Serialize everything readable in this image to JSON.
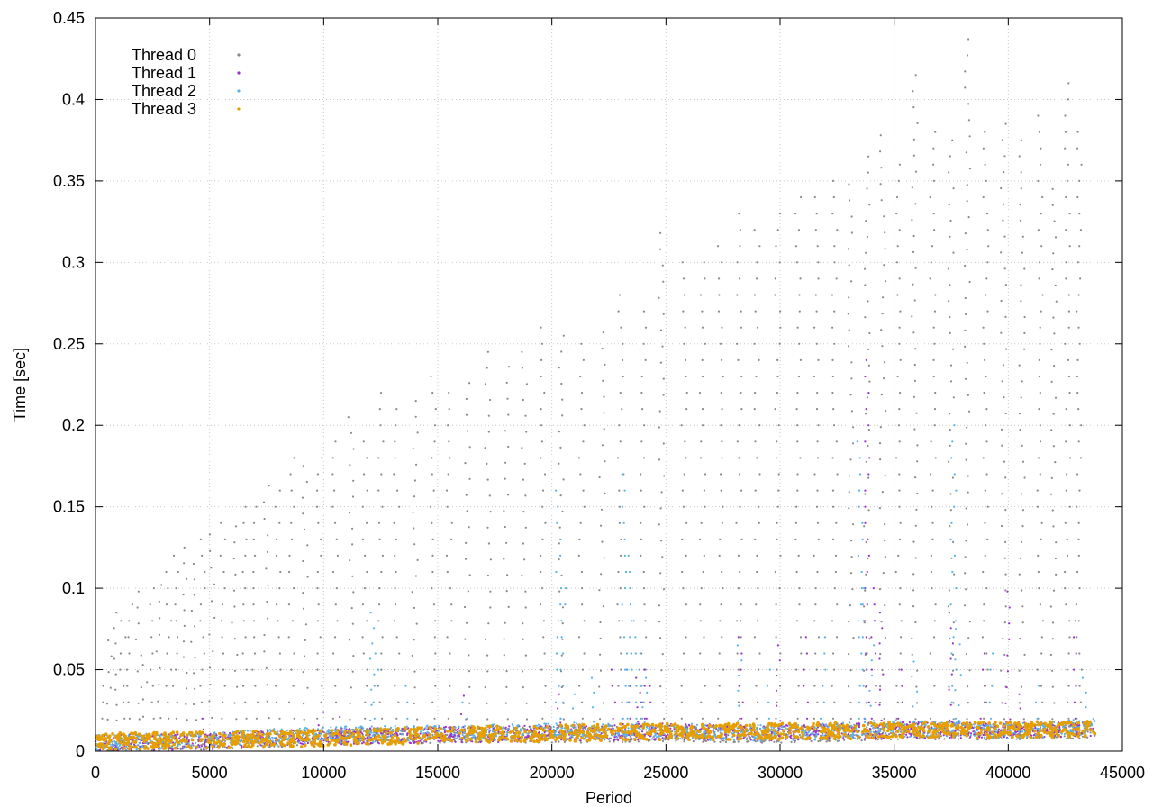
{
  "chart_data": {
    "type": "scatter",
    "title": "",
    "xlabel": "Period",
    "ylabel": "Time [sec]",
    "xlim": [
      0,
      45000
    ],
    "ylim": [
      0,
      0.45
    ],
    "x_ticks": [
      0,
      5000,
      10000,
      15000,
      20000,
      25000,
      30000,
      35000,
      40000,
      45000
    ],
    "x_tick_labels": [
      "0",
      "5000",
      "10000",
      "15000",
      "20000",
      "25000",
      "30000",
      "35000",
      "40000",
      "45000"
    ],
    "y_ticks": [
      0,
      0.05,
      0.1,
      0.15,
      0.2,
      0.25,
      0.3,
      0.35,
      0.4,
      0.45
    ],
    "y_tick_labels": [
      "0",
      "0.05",
      "0.1",
      "0.15",
      "0.2",
      "0.25",
      "0.3",
      "0.35",
      "0.4",
      "0.45"
    ],
    "grid": true,
    "legend_position": "top-left",
    "x_extent": 43800,
    "series": [
      {
        "name": "Thread 0",
        "color": "#8a8a8a",
        "baseline": [
          [
            0,
            0.004
          ],
          [
            5000,
            0.006
          ],
          [
            10000,
            0.008
          ],
          [
            15000,
            0.01
          ],
          [
            20000,
            0.01
          ],
          [
            25000,
            0.011
          ],
          [
            30000,
            0.01
          ],
          [
            35000,
            0.012
          ],
          [
            40000,
            0.012
          ],
          [
            43800,
            0.013
          ]
        ],
        "outliers": [
          [
            300,
            0.04
          ],
          [
            600,
            0.068
          ],
          [
            900,
            0.085
          ],
          [
            1200,
            0.08
          ],
          [
            1500,
            0.09
          ],
          [
            1900,
            0.098
          ],
          [
            2200,
            0.053
          ],
          [
            2500,
            0.1
          ],
          [
            2800,
            0.102
          ],
          [
            3200,
            0.11
          ],
          [
            3500,
            0.12
          ],
          [
            3900,
            0.125
          ],
          [
            4300,
            0.115
          ],
          [
            4700,
            0.13
          ],
          [
            5100,
            0.133
          ],
          [
            5600,
            0.14
          ],
          [
            6100,
            0.138
          ],
          [
            6500,
            0.15
          ],
          [
            7000,
            0.15
          ],
          [
            7500,
            0.163
          ],
          [
            8000,
            0.16
          ],
          [
            8600,
            0.18
          ],
          [
            9200,
            0.175
          ],
          [
            9800,
            0.18
          ],
          [
            10500,
            0.19
          ],
          [
            11200,
            0.205
          ],
          [
            11800,
            0.19
          ],
          [
            12500,
            0.22
          ],
          [
            13200,
            0.21
          ],
          [
            14000,
            0.215
          ],
          [
            14800,
            0.23
          ],
          [
            15500,
            0.22
          ],
          [
            16300,
            0.226
          ],
          [
            17200,
            0.245
          ],
          [
            18000,
            0.236
          ],
          [
            18800,
            0.245
          ],
          [
            19600,
            0.26
          ],
          [
            20400,
            0.255
          ],
          [
            21300,
            0.25
          ],
          [
            22200,
            0.257
          ],
          [
            23000,
            0.28
          ],
          [
            24000,
            0.27
          ],
          [
            24800,
            0.318
          ],
          [
            25800,
            0.3
          ],
          [
            26600,
            0.3
          ],
          [
            27400,
            0.31
          ],
          [
            28200,
            0.33
          ],
          [
            29000,
            0.32
          ],
          [
            29900,
            0.33
          ],
          [
            30800,
            0.34
          ],
          [
            31600,
            0.34
          ],
          [
            32400,
            0.35
          ],
          [
            33100,
            0.348
          ],
          [
            33800,
            0.365
          ],
          [
            34500,
            0.378
          ],
          [
            35200,
            0.36
          ],
          [
            35900,
            0.415
          ],
          [
            36700,
            0.38
          ],
          [
            37500,
            0.375
          ],
          [
            38200,
            0.437
          ],
          [
            39000,
            0.38
          ],
          [
            39800,
            0.385
          ],
          [
            40600,
            0.375
          ],
          [
            41400,
            0.39
          ],
          [
            42000,
            0.345
          ],
          [
            42600,
            0.41
          ],
          [
            43100,
            0.38
          ]
        ]
      },
      {
        "name": "Thread 1",
        "color": "#9b30d0",
        "baseline": [
          [
            0,
            0.005
          ],
          [
            5000,
            0.006
          ],
          [
            10000,
            0.009
          ],
          [
            15000,
            0.01
          ],
          [
            20000,
            0.011
          ],
          [
            25000,
            0.012
          ],
          [
            30000,
            0.011
          ],
          [
            35000,
            0.013
          ],
          [
            40000,
            0.013
          ],
          [
            43800,
            0.014
          ]
        ],
        "outliers": [
          [
            4800,
            0.02
          ],
          [
            9900,
            0.024
          ],
          [
            10700,
            0.021
          ],
          [
            16100,
            0.034
          ],
          [
            20300,
            0.035
          ],
          [
            22700,
            0.05
          ],
          [
            23400,
            0.06
          ],
          [
            23800,
            0.045
          ],
          [
            24000,
            0.05
          ],
          [
            24200,
            0.04
          ],
          [
            28300,
            0.08
          ],
          [
            29900,
            0.065
          ],
          [
            31100,
            0.07
          ],
          [
            33800,
            0.24
          ],
          [
            34100,
            0.1
          ],
          [
            34400,
            0.085
          ],
          [
            35300,
            0.05
          ],
          [
            37500,
            0.085
          ],
          [
            38900,
            0.06
          ],
          [
            40000,
            0.098
          ],
          [
            40600,
            0.035
          ],
          [
            42900,
            0.08
          ]
        ]
      },
      {
        "name": "Thread 2",
        "color": "#56b4e9",
        "baseline": [
          [
            0,
            0.005
          ],
          [
            5000,
            0.007
          ],
          [
            10000,
            0.01
          ],
          [
            15000,
            0.011
          ],
          [
            20000,
            0.012
          ],
          [
            25000,
            0.012
          ],
          [
            30000,
            0.011
          ],
          [
            35000,
            0.014
          ],
          [
            40000,
            0.012
          ],
          [
            43800,
            0.015
          ]
        ],
        "outliers": [
          [
            12100,
            0.085
          ],
          [
            12300,
            0.06
          ],
          [
            13700,
            0.04
          ],
          [
            16200,
            0.03
          ],
          [
            20300,
            0.16
          ],
          [
            20500,
            0.1
          ],
          [
            20900,
            0.035
          ],
          [
            21800,
            0.045
          ],
          [
            23200,
            0.17
          ],
          [
            23400,
            0.12
          ],
          [
            23600,
            0.08
          ],
          [
            23900,
            0.06
          ],
          [
            24100,
            0.045
          ],
          [
            28200,
            0.065
          ],
          [
            29500,
            0.05
          ],
          [
            31900,
            0.07
          ],
          [
            33500,
            0.19
          ],
          [
            33700,
            0.1
          ],
          [
            34000,
            0.065
          ],
          [
            35900,
            0.055
          ],
          [
            37600,
            0.2
          ],
          [
            37800,
            0.075
          ],
          [
            39200,
            0.06
          ],
          [
            41300,
            0.04
          ],
          [
            43300,
            0.045
          ]
        ]
      },
      {
        "name": "Thread 3",
        "color": "#e69f00",
        "baseline": [
          [
            0,
            0.006
          ],
          [
            5000,
            0.007
          ],
          [
            10000,
            0.008
          ],
          [
            15000,
            0.01
          ],
          [
            20000,
            0.011
          ],
          [
            25000,
            0.012
          ],
          [
            30000,
            0.012
          ],
          [
            35000,
            0.013
          ],
          [
            40000,
            0.013
          ],
          [
            43800,
            0.014
          ]
        ],
        "outliers": []
      }
    ]
  }
}
